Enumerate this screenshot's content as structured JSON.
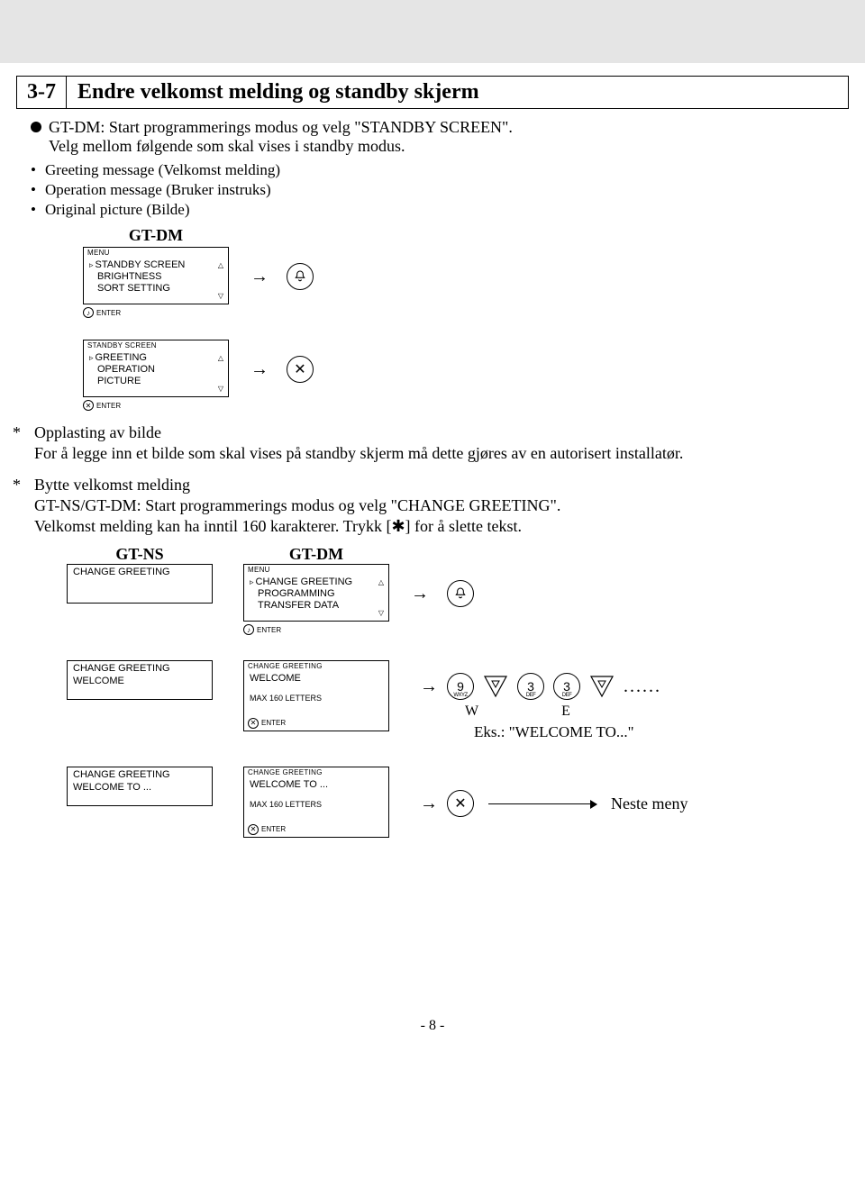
{
  "section": {
    "num": "3-7",
    "title": "Endre velkomst melding og standby skjerm"
  },
  "lead": "GT-DM: Start programmerings modus og velg \"STANDBY SCREEN\".",
  "lead2": "Velg mellom følgende som skal vises i standby modus.",
  "list": {
    "a": "Greeting message (Velkomst melding)",
    "b": "Operation message (Bruker instruks)",
    "c": "Original picture (Bilde)"
  },
  "labels": {
    "gtdm": "GT-DM",
    "gtns": "GT-NS"
  },
  "lcd1": {
    "hdr": "MENU",
    "l1": "STANDBY SCREEN",
    "l2": "BRIGHTNESS",
    "l3": "SORT SETTING",
    "foot": "ENTER"
  },
  "lcd2": {
    "hdr": "STANDBY SCREEN",
    "l1": "GREETING",
    "l2": "OPERATION",
    "l3": "PICTURE",
    "foot": "ENTER"
  },
  "opplast": {
    "title": "Opplasting av bilde",
    "body": "For å legge inn et bilde som skal vises på standby skjerm må dette gjøres av en autorisert installatør."
  },
  "bytte": {
    "title": "Bytte velkomst melding",
    "l1": "GT-NS/GT-DM: Start programmerings modus og velg \"CHANGE GREETING\".",
    "l2": "Velkomst melding kan ha inntil 160 karakterer. Trykk [✱] for å slette tekst."
  },
  "lcd_ns1": {
    "l1": "CHANGE GREETING"
  },
  "lcd_dm_menu": {
    "hdr": "MENU",
    "l1": "CHANGE GREETING",
    "l2": "PROGRAMMING",
    "l3": "TRANSFER DATA",
    "foot": "ENTER"
  },
  "lcd_ns2": {
    "l1": "CHANGE GREETING",
    "l2": "WELCOME"
  },
  "lcd_dm2": {
    "hdr": "CHANGE GREETING",
    "l1": "WELCOME",
    "max": "MAX 160 LETTERS",
    "foot": "ENTER"
  },
  "lcd_ns3": {
    "l1": "CHANGE GREETING",
    "l2": "WELCOME TO ..."
  },
  "lcd_dm3": {
    "hdr": "CHANGE GREETING",
    "l1": "WELCOME TO ...",
    "max": "MAX 160 LETTERS",
    "foot": "ENTER"
  },
  "keys": {
    "k9": "9",
    "k9s": "WXYZ",
    "k3": "3",
    "k3s": "DEF",
    "dots": "......",
    "W": "W",
    "E": "E",
    "eks": "Eks.: \"WELCOME TO...\""
  },
  "neste": "Neste meny",
  "pagenum": "- 8 -",
  "tri_up": "△",
  "tri_dn": "▽"
}
